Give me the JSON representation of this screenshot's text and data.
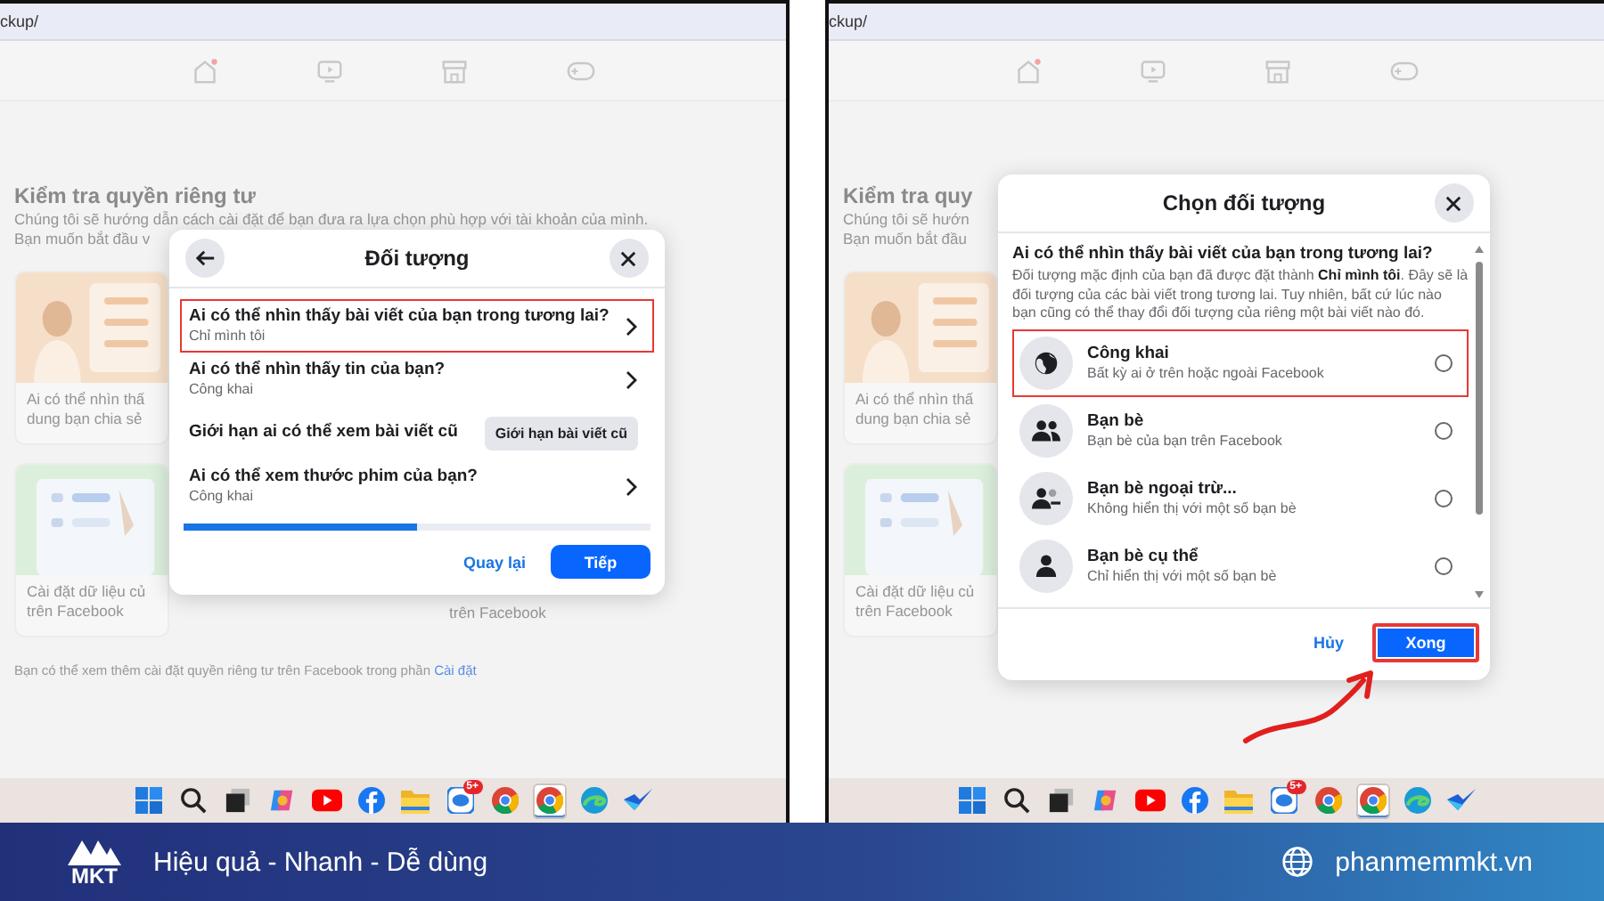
{
  "panels": [
    {
      "url": "ckup/",
      "background": {
        "heading": "Kiểm tra quyền riêng tư",
        "intro": [
          "Chúng tôi sẽ hướng dẫn cách cài đặt để bạn đưa ra lựa chọn phù hợp với tài khoản của mình.",
          "Bạn muốn bắt đầu v"
        ],
        "rows": [
          [
            {
              "kind": "privacy",
              "lines": [
                "Ai có thể nhìn thấ",
                "dung bạn chia sẻ"
              ]
            }
          ],
          [
            {
              "kind": "data",
              "lines": [
                "Cài đặt dữ liệu củ",
                "trên Facebook"
              ]
            },
            {
              "kind": "plain",
              "lines": [
                "trên Facebook"
              ]
            }
          ]
        ],
        "note": {
          "text": "Bạn có thể xem thêm cài đặt quyền riêng tư trên Facebook trong phần",
          "link": "Cài đặt"
        }
      },
      "dialog": {
        "kind": "steps",
        "title": "Đối tượng",
        "items": [
          {
            "kind": "link",
            "title": "Ai có thể nhìn thấy bài viết của bạn trong tương lai?",
            "subtitle": "Chỉ mình tôi",
            "highlighted": true
          },
          {
            "kind": "link",
            "title": "Ai có thể nhìn thấy tin của bạn?",
            "subtitle": "Công khai",
            "highlighted": false
          },
          {
            "kind": "action",
            "title": "Giới hạn ai có thể xem bài viết cũ",
            "button": "Giới hạn bài viết cũ",
            "highlighted": false
          },
          {
            "kind": "link",
            "title": "Ai có thể xem thước phim của bạn?",
            "subtitle": "Công khai",
            "highlighted": false
          }
        ],
        "progress": {
          "level": 0.5
        },
        "back": "Quay lại",
        "next": "Tiếp"
      },
      "taskbar": [
        {
          "kind": "start",
          "active": false
        },
        {
          "kind": "search",
          "active": false
        },
        {
          "kind": "taskview",
          "active": false
        },
        {
          "kind": "copilot",
          "active": false
        },
        {
          "kind": "video",
          "active": false
        },
        {
          "kind": "social",
          "active": false
        },
        {
          "kind": "folder",
          "active": false
        },
        {
          "kind": "chat",
          "active": false,
          "badge": "5+"
        },
        {
          "kind": "browser",
          "active": false
        },
        {
          "kind": "browser",
          "active": true
        },
        {
          "kind": "edge",
          "active": false
        },
        {
          "kind": "check",
          "active": false
        }
      ]
    },
    {
      "url": "ckup/",
      "pointer_arrow": true,
      "background": {
        "heading": "Kiểm tra quy",
        "intro": [
          "Chúng tôi sẽ hướn",
          "Bạn muốn bắt đầu"
        ],
        "rows": [
          [
            {
              "kind": "privacy",
              "lines": [
                "Ai có thể nhìn thấ",
                "dung bạn chia sẻ"
              ]
            }
          ],
          [
            {
              "kind": "data",
              "lines": [
                "Cài đặt dữ liệu củ",
                "trên Facebook"
              ]
            }
          ]
        ]
      },
      "dialog": {
        "kind": "picker",
        "title": "Chọn đối tượng",
        "question": "Ai có thể nhìn thấy bài viết của bạn trong tương lai?",
        "description": "Đối tượng mặc định của bạn đã được đặt thành **Chỉ mình tôi**. Đây sẽ là đối tượng của các bài viết trong tương lai. Tuy nhiên, bất cứ lúc nào bạn cũng có thể thay đổi đối tượng của riêng một bài viết nào đó.",
        "options": [
          {
            "kind": "public",
            "title": "Công khai",
            "subtitle": "Bất kỳ ai ở trên hoặc ngoài Facebook",
            "selected": false,
            "highlighted": true
          },
          {
            "kind": "friends",
            "title": "Bạn bè",
            "subtitle": "Bạn bè của bạn trên Facebook",
            "selected": false,
            "highlighted": false
          },
          {
            "kind": "except",
            "title": "Bạn bè ngoại trừ...",
            "subtitle": "Không hiển thị với một số bạn bè",
            "selected": false,
            "highlighted": false
          },
          {
            "kind": "specific",
            "title": "Bạn bè cụ thể",
            "subtitle": "Chỉ hiển thị với một số bạn bè",
            "selected": false,
            "highlighted": false
          }
        ],
        "cancel": "Hủy",
        "done": "Xong",
        "done_highlighted": true
      },
      "taskbar": [
        {
          "kind": "start",
          "active": false
        },
        {
          "kind": "search",
          "active": false
        },
        {
          "kind": "taskview",
          "active": false
        },
        {
          "kind": "copilot",
          "active": false
        },
        {
          "kind": "video",
          "active": false
        },
        {
          "kind": "social",
          "active": false
        },
        {
          "kind": "folder",
          "active": false
        },
        {
          "kind": "chat",
          "active": false,
          "badge": "5+"
        },
        {
          "kind": "browser",
          "active": false
        },
        {
          "kind": "browser",
          "active": true
        },
        {
          "kind": "edge",
          "active": false
        },
        {
          "kind": "check",
          "active": false
        }
      ]
    }
  ],
  "banner": {
    "logo": "MKT",
    "tagline": "Hiệu quả - Nhanh - Dễ dùng",
    "website": "phanmemmkt.vn"
  }
}
